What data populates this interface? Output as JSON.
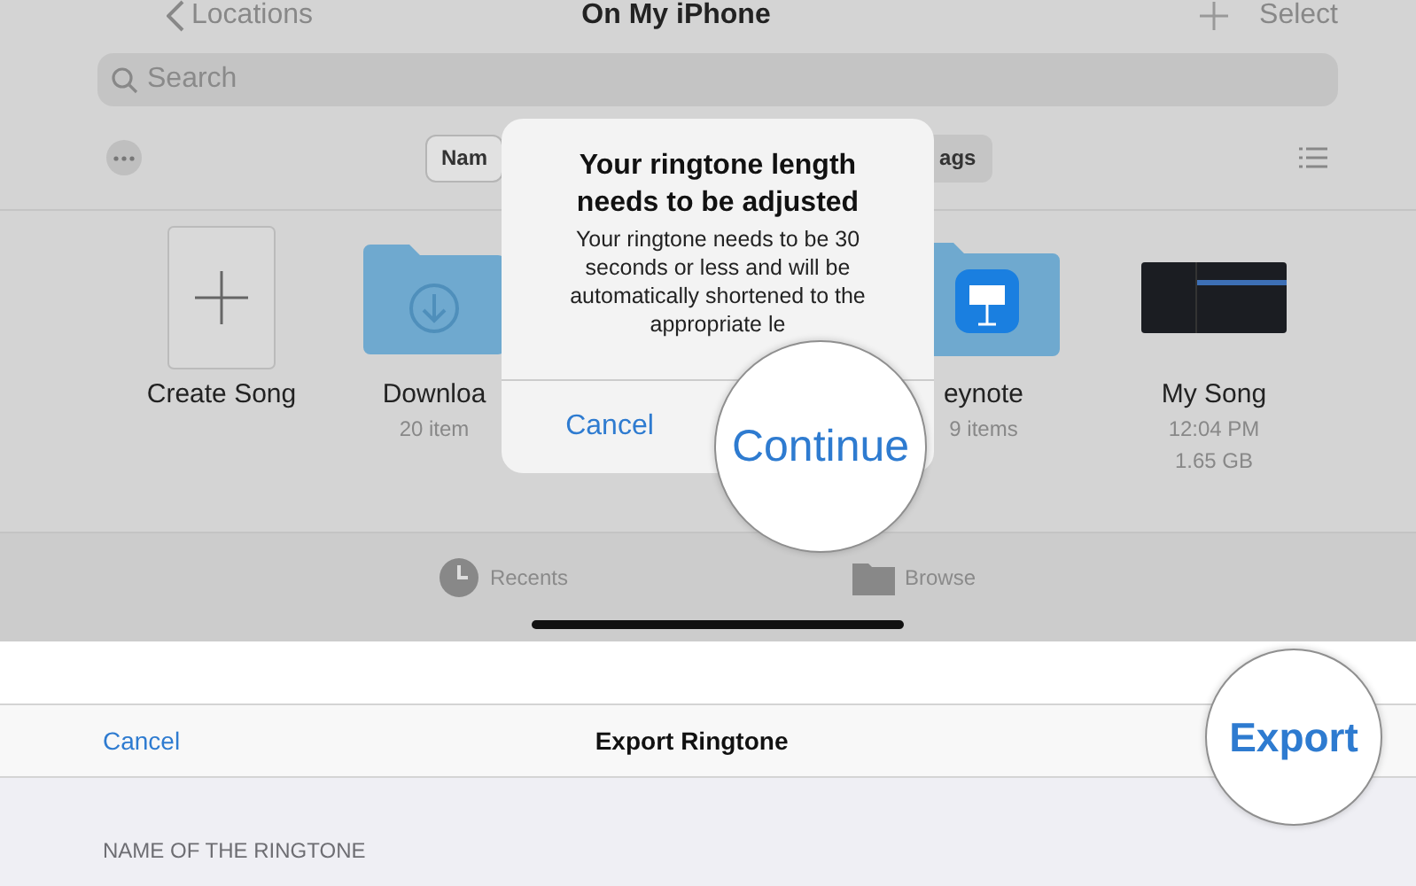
{
  "nav": {
    "back": "Locations",
    "title": "On My iPhone",
    "select": "Select"
  },
  "search": {
    "placeholder": "Search"
  },
  "sort": [
    {
      "label": "Nam",
      "selected": true
    },
    {
      "label": "ags",
      "selected": false
    }
  ],
  "items": [
    {
      "kind": "create",
      "name": "Create Song"
    },
    {
      "kind": "download",
      "name": "Downloa",
      "detail": [
        "20 item"
      ]
    },
    {
      "kind": "keynote",
      "name": "eynote",
      "detail": [
        "9 items"
      ]
    },
    {
      "kind": "song",
      "name": "My Song",
      "detail": [
        "12:04 PM",
        "1.65 GB"
      ]
    }
  ],
  "tabs": [
    {
      "kind": "clock",
      "label": "Recents"
    },
    {
      "kind": "folder",
      "label": "Browse"
    }
  ],
  "alert": {
    "title": "Your ringtone length needs to be adjusted",
    "message": "Your ringtone needs to be 30 seconds or less and will be automatically shortened to the appropriate le",
    "cancel": "Cancel",
    "continue": "Continue"
  },
  "export": {
    "cancel": "Cancel",
    "title": "Export Ringtone",
    "export": "Export",
    "section": "NAME OF THE RINGTONE"
  }
}
